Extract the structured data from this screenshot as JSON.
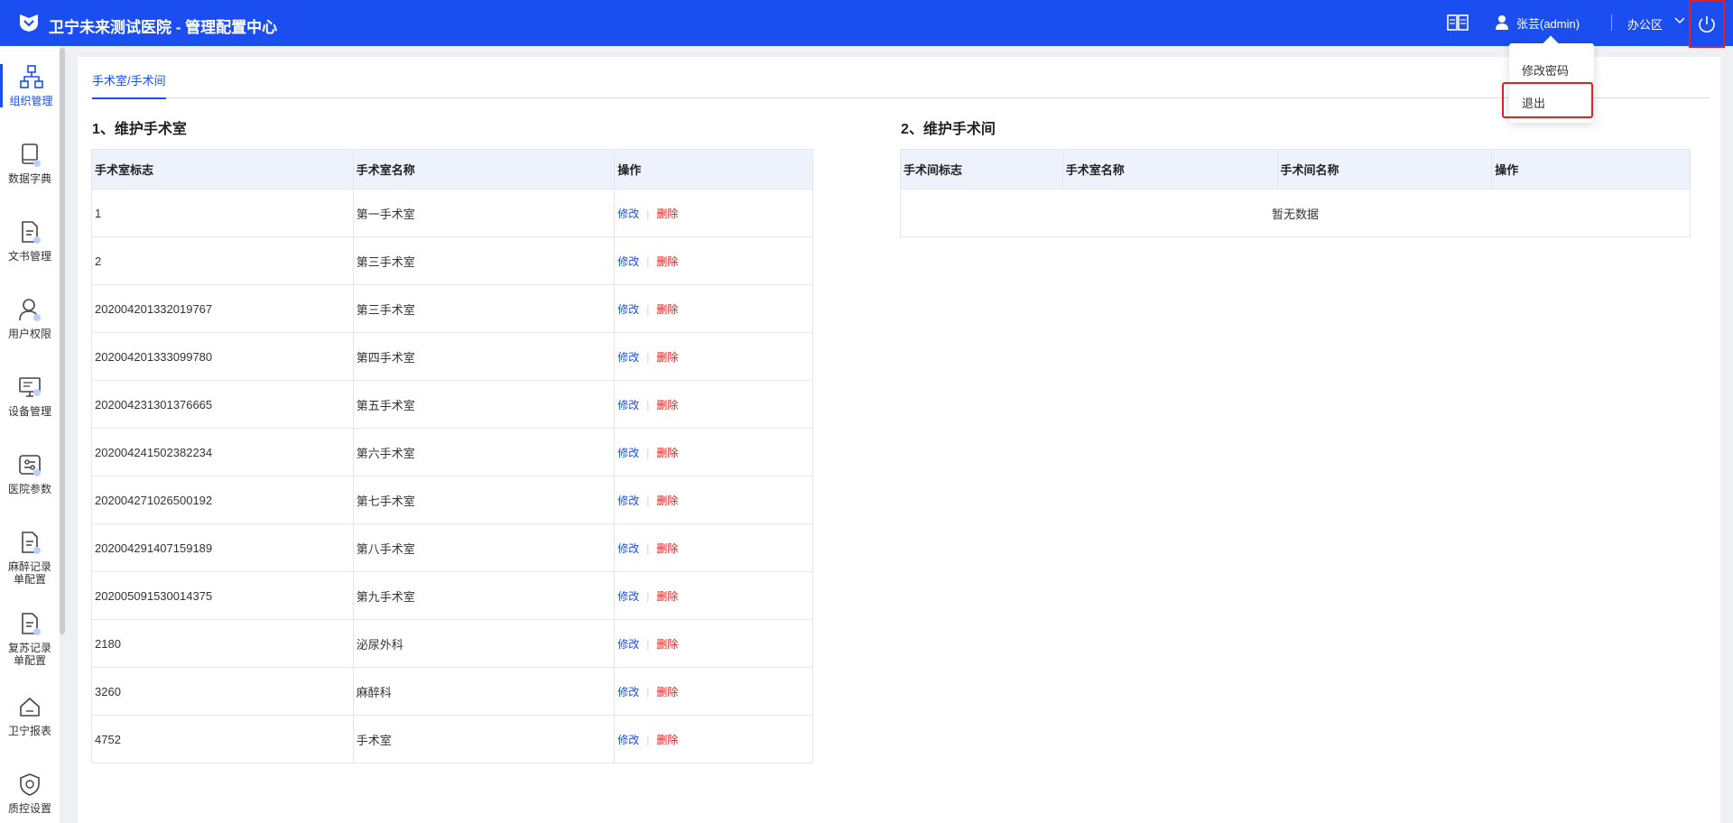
{
  "header": {
    "title": "卫宁未来测试医院 - 管理配置中心",
    "user_name": "张芸(admin)",
    "office": "办公区"
  },
  "sidebar": {
    "items": [
      {
        "label": "组织管理",
        "icon": "org-chart-icon",
        "active": true
      },
      {
        "label": "数据字典",
        "icon": "book-icon"
      },
      {
        "label": "文书管理",
        "icon": "document-icon"
      },
      {
        "label": "用户权限",
        "icon": "user-icon"
      },
      {
        "label": "设备管理",
        "icon": "monitor-icon"
      },
      {
        "label": "医院参数",
        "icon": "settings-panel-icon"
      },
      {
        "label": "麻醉记录单配置",
        "icon": "document-icon"
      },
      {
        "label": "复苏记录单配置",
        "icon": "document-icon"
      },
      {
        "label": "卫宁报表",
        "icon": "home-icon"
      },
      {
        "label": "质控设置",
        "icon": "shield-icon"
      }
    ]
  },
  "tabs": [
    {
      "label": "手术室/手术间"
    }
  ],
  "section1": {
    "title": "1、维护手术室",
    "columns": [
      "手术室标志",
      "手术室名称",
      "操作"
    ],
    "edit_label": "修改",
    "delete_label": "删除",
    "rows": [
      {
        "id": "1",
        "name": "第一手术室"
      },
      {
        "id": "2",
        "name": "第三手术室"
      },
      {
        "id": "202004201332019767",
        "name": "第三手术室"
      },
      {
        "id": "202004201333099780",
        "name": "第四手术室"
      },
      {
        "id": "202004231301376665",
        "name": "第五手术室"
      },
      {
        "id": "202004241502382234",
        "name": "第六手术室"
      },
      {
        "id": "202004271026500192",
        "name": "第七手术室"
      },
      {
        "id": "202004291407159189",
        "name": "第八手术室"
      },
      {
        "id": "202005091530014375",
        "name": "第九手术室"
      },
      {
        "id": "2180",
        "name": "泌尿外科"
      },
      {
        "id": "3260",
        "name": "麻醉科"
      },
      {
        "id": "4752",
        "name": "手术室"
      }
    ]
  },
  "section2": {
    "title": "2、维护手术间",
    "columns": [
      "手术间标志",
      "手术室名称",
      "手术间名称",
      "操作"
    ],
    "empty_text": "暂无数据"
  },
  "dropdown": {
    "items": [
      "修改密码",
      "退出"
    ]
  },
  "colors": {
    "header_bg": "#1a4ef0",
    "accent": "#1a4ef0",
    "danger": "#e02020"
  }
}
